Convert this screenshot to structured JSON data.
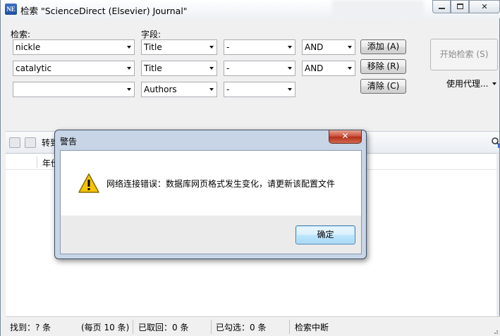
{
  "window": {
    "title": "检索 \"ScienceDirect (Elsevier) Journal\"",
    "app_icon_text": "NE"
  },
  "search": {
    "query_label": "检索:",
    "field_label": "字段:",
    "rows": [
      {
        "term": "nickle",
        "field": "Title",
        "qualifier": "-",
        "operator": "AND"
      },
      {
        "term": "catalytic",
        "field": "Title",
        "qualifier": "-",
        "operator": "AND"
      },
      {
        "term": "",
        "field": "Authors",
        "qualifier": "-"
      }
    ],
    "add_label": "添加 (A)",
    "remove_label": "移除 (R)",
    "clear_label": "清除 (C)",
    "start_label": "开始检索 (S)",
    "proxy_label": "使用代理..."
  },
  "toolbar": {
    "transfer_label": "转到"
  },
  "list": {
    "header_year": "年份"
  },
  "status": {
    "found": "找到：? 条",
    "per_page": "(每页 10 条)",
    "retrieved": "已取回：0 条",
    "checked": "已勾选：0 条",
    "state": "检索中断"
  },
  "dialog": {
    "title": "警告",
    "close_glyph": "✕",
    "message": "网络连接错误：数据库网页格式发生变化，请更新该配置文件",
    "ok_label": "确定"
  }
}
